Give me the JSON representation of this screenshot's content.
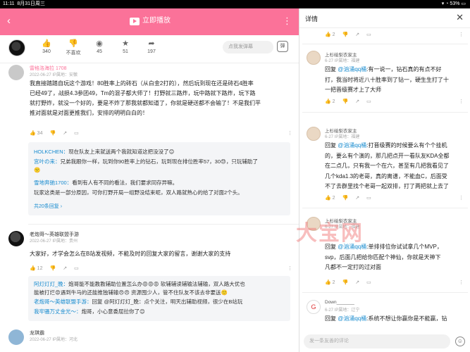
{
  "status": {
    "time": "11:11",
    "date": "8月31日周三",
    "battery": "53%"
  },
  "topbar": {
    "play_label": "立即播放"
  },
  "actions": [
    {
      "name": "like",
      "icon": "👍",
      "count": "340"
    },
    {
      "name": "dislike",
      "icon": "👎",
      "count": "不喜欢"
    },
    {
      "name": "coin",
      "icon": "◉",
      "count": "45"
    },
    {
      "name": "favorite",
      "icon": "★",
      "count": "51"
    },
    {
      "name": "share",
      "icon": "➦",
      "count": "197"
    }
  ],
  "danmu_placeholder": "点我发弹幕",
  "danmu_icon": "弹",
  "comment1": {
    "user": "雷格洛海拉 1708",
    "meta": "2022-06-27 IP属地：安徽",
    "text_lines": [
      "我直接踏踏自玩这个游戏！80胜率上的砖石（从白金2打的），然后玩到现在还是砖石4胜率",
      "已经49了，战损4.3参团49，Tm的混子都大师了！打野就三路炸，玩中路就下路炸，玩下路",
      "就打野炸，就没一个好的，要是不炸了那我就都知道了，你就是硬送都不会输了！不是我们平",
      "推对面就是对面更推我们，安排的明明白白的！"
    ],
    "likes": "34"
  },
  "replies1": {
    "lines": [
      {
        "name": "HOLKCHEN：",
        "text": "现在队友上来就送两个我就知道这把没没了😊"
      },
      {
        "name": "宫叶の来：",
        "text": "兄弟我跟你一样，玩到你90胜率上的钻石，玩到现在排位胜率57，30😓，只玩辅助了"
      },
      {
        "name": "",
        "text": "🙁"
      },
      {
        "name": "雪地奔驰1700：",
        "text": "看到有人有不同的看法，我们要求同存异嘛。"
      },
      {
        "name": "",
        "text": "玩家这类是一部分原因，可你打野开局一组野没结束呢，双人路就熟心的给了对面2个头。"
      }
    ],
    "more": "共20条回复 ›"
  },
  "comment2": {
    "user": "老炮哥～英雄联盟手游",
    "meta": "2022-06-27 IP属地：贵州",
    "text": "大家好，才学会怎么在B站发视频，不能及时的回复大家的留言，谢谢大家的支持",
    "likes": "12"
  },
  "replies2": {
    "lines": [
      {
        "name": "阿灯灯灯_晚：",
        "text": "炮哥能不能教教辅助位置怎么办😡😡😡 软辅辅读辅输法辅输，双人路大优也"
      },
      {
        "name": "",
        "text": "能被打烂😡遇到牛马的还能推独辅输😠😠 资源囤少人，管不住队友不该去非要送🙂"
      },
      {
        "name": "老炮哥～英雄联盟手游：",
        "text": "回复 @阿灯灯灯_晚：点个关注，明天出辅助视频，很少在B站玩"
      },
      {
        "name": "我牢骚万丈金光～：",
        "text": "炮哥，小心意委屈拉你了😊"
      }
    ]
  },
  "comment3": {
    "user": "龙琪霸",
    "meta": "2022-06-27 IP属地：河北"
  },
  "detail": {
    "title": "详情",
    "top_likes": "2",
    "watermark": "大宝网",
    "input_placeholder": "发一条友善的评论",
    "items": [
      {
        "user": "上杉绘梨衣家主",
        "meta": "6-27 IP属地：福建",
        "prefix": "回复 ",
        "at": "@汹涌qq桶",
        "lines": [
          ":有一说一，钻石真的有点不好",
          "打，我当时将近八十胜率到了钻一，硬生生打了十",
          "一把晋级赛才上了大师"
        ],
        "likes": "2"
      },
      {
        "user": "上杉绘梨衣家主",
        "meta": "6-27 IP属地：福建",
        "prefix": "回复 ",
        "at": "@汹涌qq桶",
        "lines": [
          ":打晋级赛的时候要么有个个挂机",
          "的，要么有个演的，那几把点开一看队友KDA全都",
          "在二点几，只有我一个在六，甚至有几把我看见了",
          "几个kda1.3的老哥，真的离谱，不能血C，后面受",
          "不了去群里找个老哥一起双排，打了两把就上去了"
        ],
        "likes": "2"
      },
      {
        "user": "上杉绘梨衣家主",
        "meta": "6-27 IP属地：福建",
        "prefix": "回复 ",
        "at": "@汹涌qq桶",
        "lines": [
          ":单排排位你试试拿几个MVP，",
          "svp，后面几把给你匹配个神仙，你就是天神下",
          "凡都不一定打的过对面"
        ],
        "likes": "2"
      },
      {
        "user": "Down_______",
        "meta": "6-27 IP属地：辽宁",
        "prefix": "回复 ",
        "at": "@汹涌qq桶",
        "lines": [
          ":系统不想让你赢你是不能赢，钻"
        ],
        "likes": ""
      }
    ]
  }
}
